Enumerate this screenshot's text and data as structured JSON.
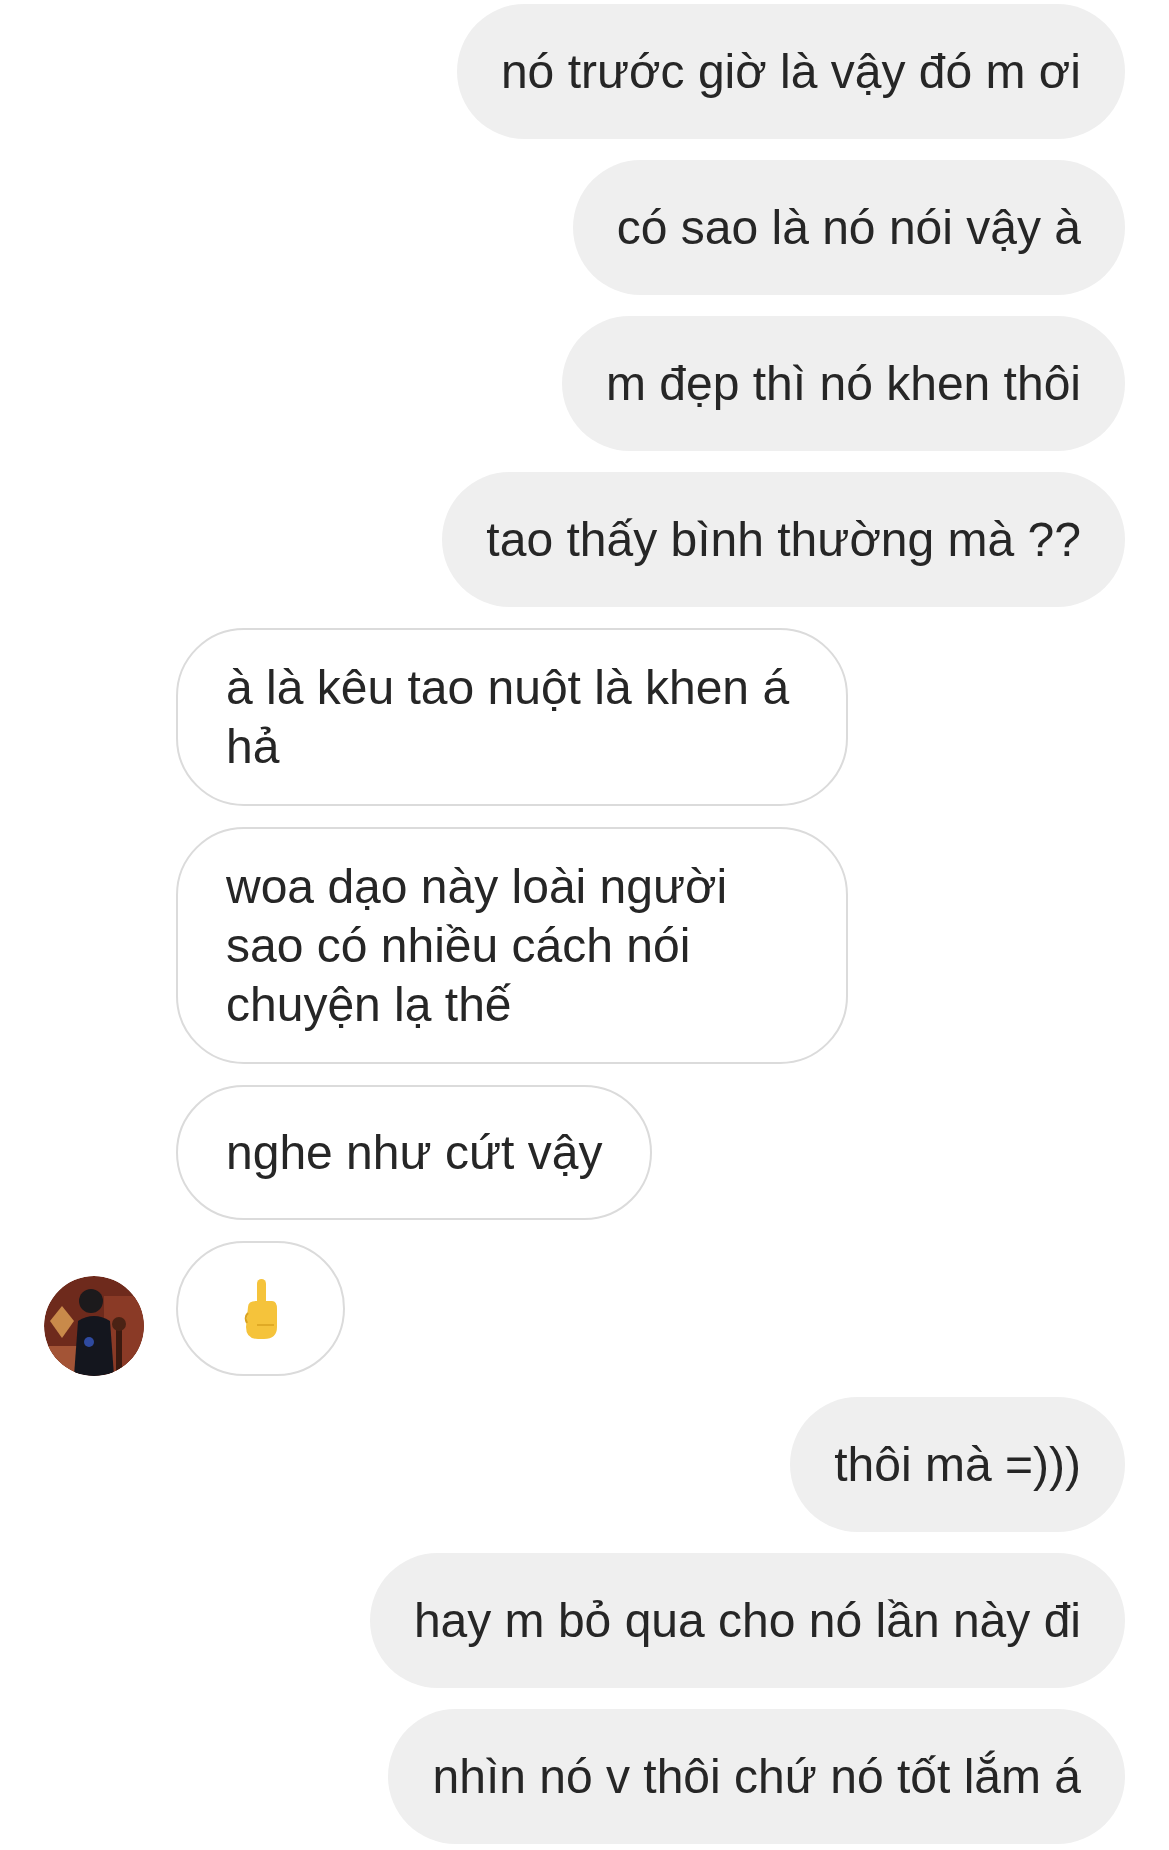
{
  "messages": [
    {
      "outgoing": true,
      "kind": "text",
      "text": "nó trước giờ là vậy đó m ơi"
    },
    {
      "outgoing": true,
      "kind": "text",
      "text": "có sao là nó nói vậy à"
    },
    {
      "outgoing": true,
      "kind": "text",
      "text": "m đẹp thì nó khen thôi"
    },
    {
      "outgoing": true,
      "kind": "text",
      "text": "tao thấy bình thường mà ??"
    },
    {
      "outgoing": false,
      "kind": "text",
      "text": "à là kêu tao nuột là khen á hả",
      "avatar": false
    },
    {
      "outgoing": false,
      "kind": "text",
      "text": "woa dạo này loài người sao có nhiều cách nói chuyện lạ thế",
      "avatar": false
    },
    {
      "outgoing": false,
      "kind": "text",
      "text": "nghe như cứt vậy",
      "avatar": false
    },
    {
      "outgoing": false,
      "kind": "emoji",
      "avatar": true
    },
    {
      "outgoing": true,
      "kind": "text",
      "text": "thôi mà =)))"
    },
    {
      "outgoing": true,
      "kind": "text",
      "text": "hay m bỏ qua cho nó lần này đi"
    },
    {
      "outgoing": true,
      "kind": "text",
      "text": "nhìn nó v thôi chứ nó tốt lắm á"
    }
  ]
}
